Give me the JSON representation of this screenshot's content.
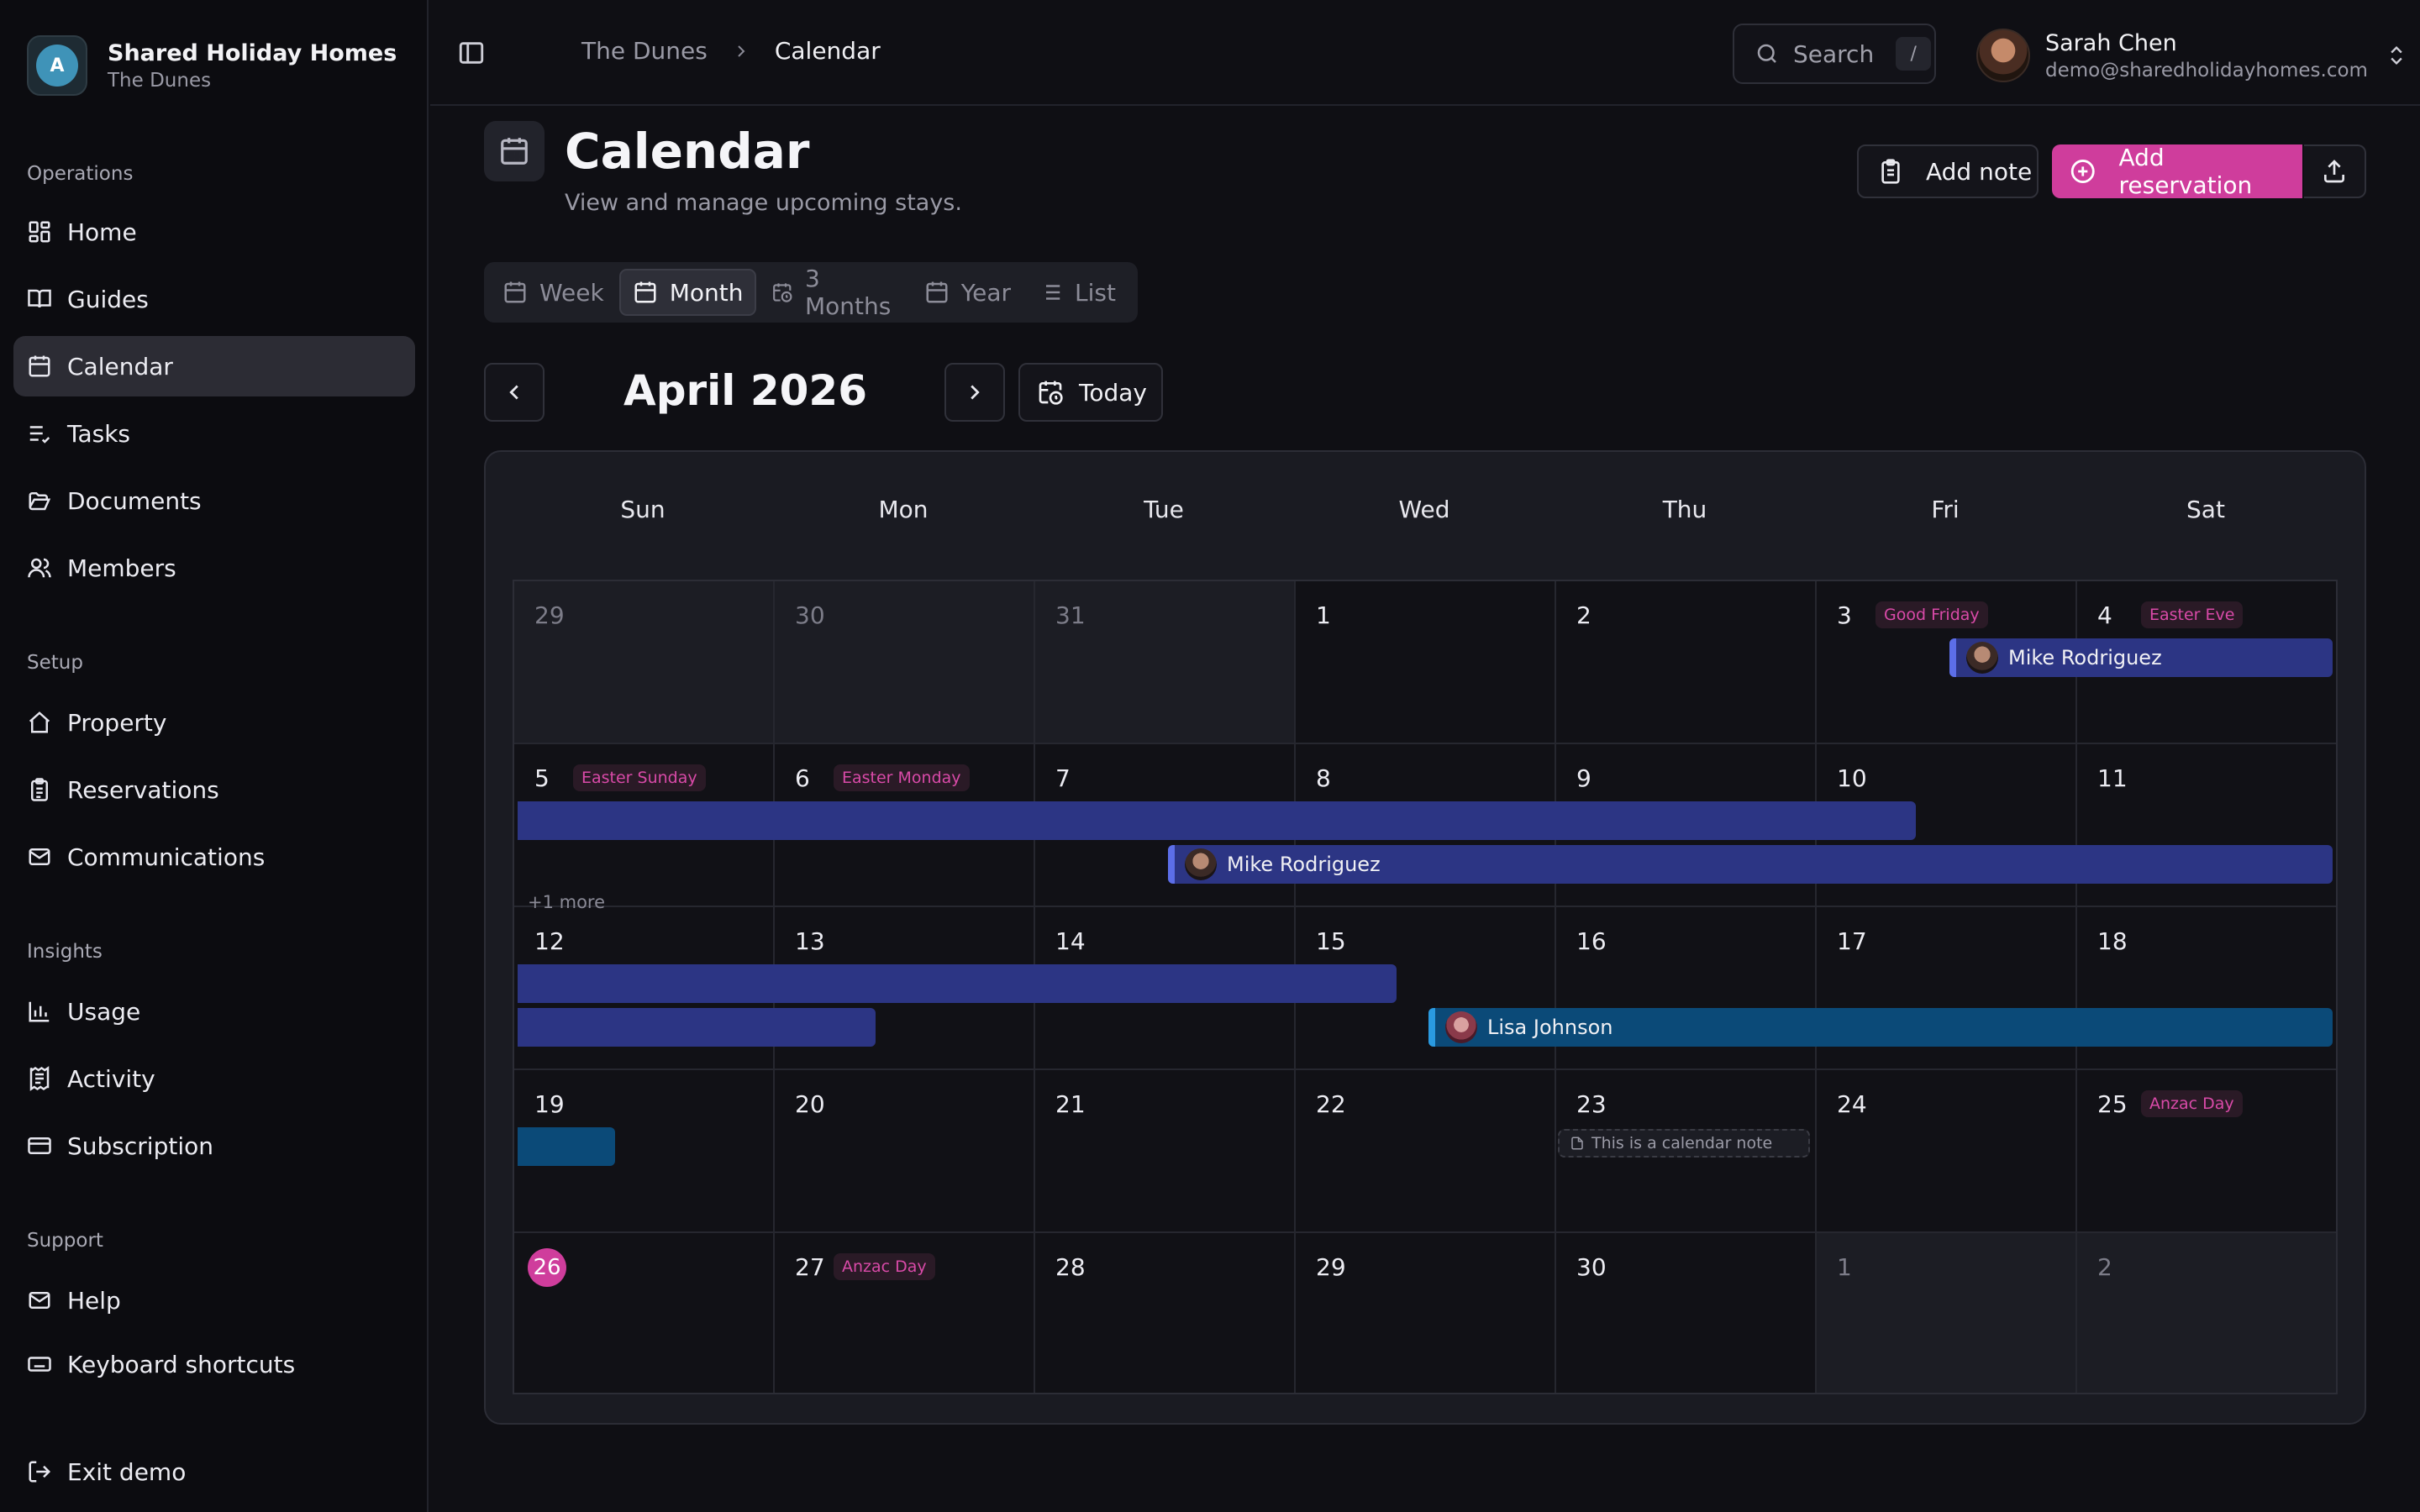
{
  "brand": {
    "name": "Shared Holiday Homes",
    "subtitle": "The Dunes",
    "logo_letter": "A"
  },
  "sidebar": {
    "sections": [
      {
        "title": "Operations",
        "items": [
          "Home",
          "Guides",
          "Calendar",
          "Tasks",
          "Documents",
          "Members"
        ]
      },
      {
        "title": "Setup",
        "items": [
          "Property",
          "Reservations",
          "Communications"
        ]
      },
      {
        "title": "Insights",
        "items": [
          "Usage",
          "Activity",
          "Subscription"
        ]
      },
      {
        "title": "Support",
        "items": [
          "Help",
          "Keyboard shortcuts"
        ]
      }
    ],
    "active_item": "Calendar",
    "exit_label": "Exit demo"
  },
  "topbar": {
    "breadcrumb": [
      "The Dunes",
      "Calendar"
    ],
    "search_placeholder": "Search",
    "search_shortcut": "/",
    "user": {
      "name": "Sarah Chen",
      "email": "demo@sharedholidayhomes.com"
    }
  },
  "page": {
    "title": "Calendar",
    "subtitle": "View and manage upcoming stays.",
    "add_note_label": "Add note",
    "add_reservation_label": "Add reservation"
  },
  "views": {
    "tabs": [
      "Week",
      "Month",
      "3 Months",
      "Year",
      "List"
    ],
    "active": "Month"
  },
  "month_nav": {
    "label": "April 2026",
    "today_label": "Today"
  },
  "calendar": {
    "weekdays": [
      "Sun",
      "Mon",
      "Tue",
      "Wed",
      "Thu",
      "Fri",
      "Sat"
    ],
    "weeks": [
      [
        {
          "d": "29",
          "out": true
        },
        {
          "d": "30",
          "out": true
        },
        {
          "d": "31",
          "out": true
        },
        {
          "d": "1"
        },
        {
          "d": "2"
        },
        {
          "d": "3",
          "holiday": "Good Friday"
        },
        {
          "d": "4",
          "holiday": "Easter Eve"
        }
      ],
      [
        {
          "d": "5",
          "holiday": "Easter Sunday",
          "more": "+1 more"
        },
        {
          "d": "6",
          "holiday": "Easter Monday"
        },
        {
          "d": "7"
        },
        {
          "d": "8"
        },
        {
          "d": "9"
        },
        {
          "d": "10"
        },
        {
          "d": "11"
        }
      ],
      [
        {
          "d": "12"
        },
        {
          "d": "13"
        },
        {
          "d": "14"
        },
        {
          "d": "15"
        },
        {
          "d": "16"
        },
        {
          "d": "17"
        },
        {
          "d": "18"
        }
      ],
      [
        {
          "d": "19"
        },
        {
          "d": "20"
        },
        {
          "d": "21"
        },
        {
          "d": "22"
        },
        {
          "d": "23"
        },
        {
          "d": "24"
        },
        {
          "d": "25",
          "holiday": "Anzac Day"
        }
      ],
      [
        {
          "d": "26",
          "today": true
        },
        {
          "d": "27",
          "holiday": "Anzac Day"
        },
        {
          "d": "28"
        },
        {
          "d": "29"
        },
        {
          "d": "30"
        },
        {
          "d": "1",
          "out": true
        },
        {
          "d": "2",
          "out": true
        }
      ]
    ],
    "reservations": [
      {
        "name": "Mike Rodriguez",
        "color": "#2c3584"
      },
      {
        "name": "Mike Rodriguez",
        "color": "#2c3584"
      },
      {
        "name": "Lisa Johnson",
        "color": "#0b4a78"
      }
    ],
    "note": "This is a calendar note"
  },
  "colors": {
    "accent": "#cf3d9c",
    "reservation_indigo": "#2c3584",
    "reservation_blue": "#0b4a78"
  }
}
